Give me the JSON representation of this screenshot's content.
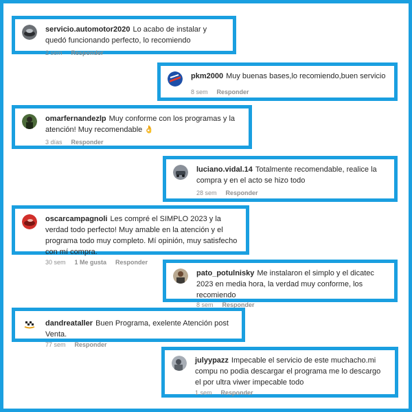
{
  "comments": [
    {
      "username": "servicio.automotor2020",
      "text": "Lo acabo de instalar y quedó funcionando perfecto, lo recomiendo",
      "time": "2 sem",
      "likes": "",
      "reply": "Responder",
      "avatar": "car-avatar"
    },
    {
      "username": "pkm2000",
      "text": "Muy buenas bases,lo recomiendo,buen servicio",
      "time": "8 sem",
      "likes": "",
      "reply": "Responder",
      "avatar": "logo-avatar"
    },
    {
      "username": "omarfernandezlp",
      "text": "Muy conforme con los programas y la atención! Muy recomendable 👌",
      "time": "3 días",
      "likes": "",
      "reply": "Responder",
      "avatar": "person-avatar"
    },
    {
      "username": "luciano.vidal.14",
      "text": "Totalmente recomendable, realice la compra y en el acto se hizo todo",
      "time": "28 sem",
      "likes": "",
      "reply": "Responder",
      "avatar": "car-avatar"
    },
    {
      "username": "oscarcampagnoli",
      "text": "Les compré el SIMPLO 2023 y la verdad todo perfecto! Muy amable en la atención y el programa todo muy completo. Mí opinión, muy satisfecho con mí compra.",
      "time": "30 sem",
      "likes": "1 Me gusta",
      "reply": "Responder",
      "avatar": "red-car-avatar"
    },
    {
      "username": "pato_potulnisky",
      "text": "Me instalaron el simplo y el dicatec 2023 en media hora, la verdad muy conforme, los recomiendo",
      "time": "8 sem",
      "likes": "",
      "reply": "Responder",
      "avatar": "person-avatar"
    },
    {
      "username": "dandreataller",
      "text": "Buen Programa, exelente Atención post Venta.",
      "time": "77 sem",
      "likes": "",
      "reply": "Responder",
      "avatar": "checkered-flag-avatar"
    },
    {
      "username": "julyypazz",
      "text": "Impecable el servicio de este muchacho.mi compu no podia descargar el programa me lo descargo el por ultra viwer impecable todo",
      "time": "1 sem",
      "likes": "",
      "reply": "Responder",
      "avatar": "person-avatar"
    }
  ],
  "colors": {
    "frame": "#1a9fe0",
    "meta_text": "#8e8e8e",
    "body_text": "#262626"
  }
}
